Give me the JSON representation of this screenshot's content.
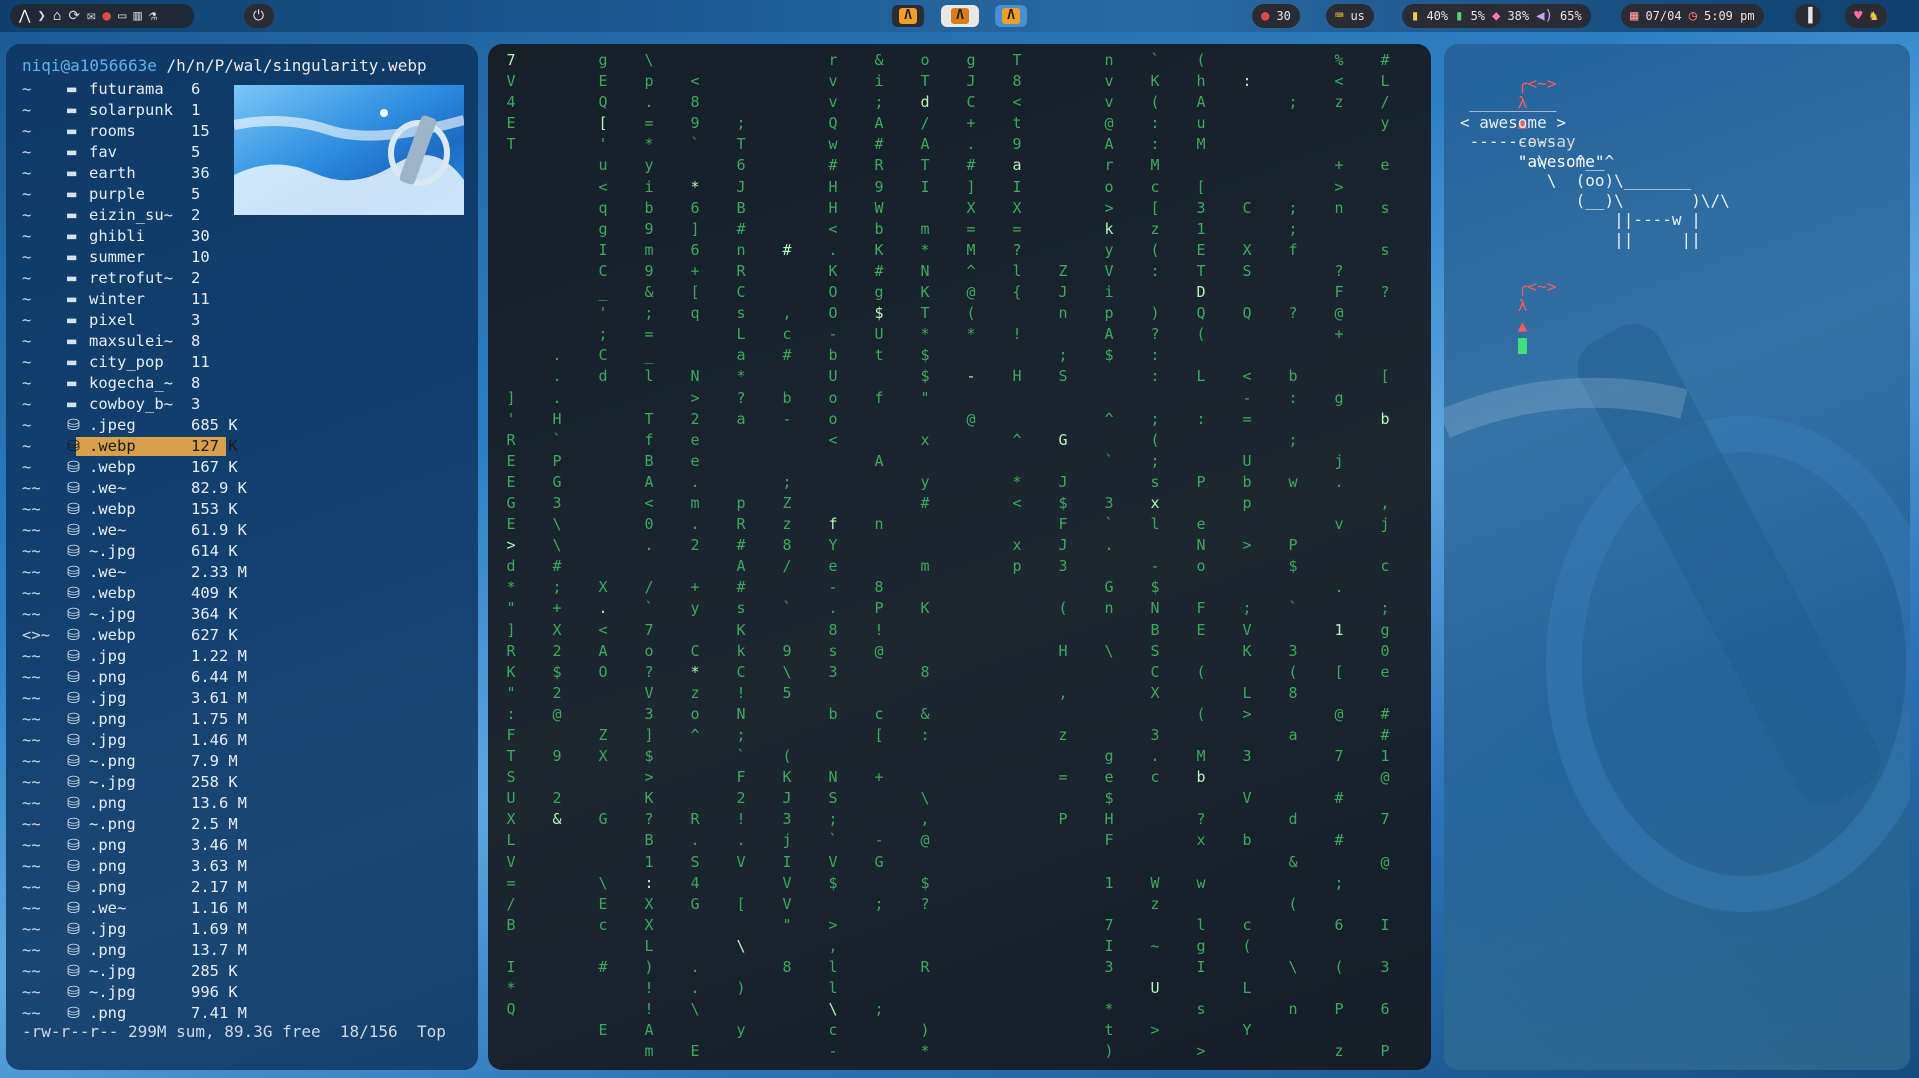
{
  "topbar": {
    "workspaces": [
      "Λ",
      "Λ",
      "Λ"
    ],
    "temperature": "30",
    "keyboard_layout": "us",
    "stats": {
      "battery": "40%",
      "disk": "5%",
      "memory": "38%",
      "volume": "65%"
    },
    "clock": {
      "date": "07/04",
      "time": "5:09 pm"
    }
  },
  "filemanager": {
    "user": "niqi@a1056663e",
    "path": "/h/n/P/wal/singularity.webp",
    "entries": [
      {
        "perm": "~",
        "name": "futurama",
        "size": "6",
        "dir": true
      },
      {
        "perm": "~",
        "name": "solarpunk",
        "size": "1",
        "dir": true
      },
      {
        "perm": "~",
        "name": "rooms",
        "size": "15",
        "dir": true
      },
      {
        "perm": "~",
        "name": "fav",
        "size": "5",
        "dir": true
      },
      {
        "perm": "~",
        "name": "earth",
        "size": "36",
        "dir": true
      },
      {
        "perm": "~",
        "name": "purple",
        "size": "5",
        "dir": true
      },
      {
        "perm": "~",
        "name": "eizin_su~",
        "size": "2",
        "dir": true
      },
      {
        "perm": "~",
        "name": "ghibli",
        "size": "30",
        "dir": true
      },
      {
        "perm": "~",
        "name": "summer",
        "size": "10",
        "dir": true
      },
      {
        "perm": "~",
        "name": "retrofut~",
        "size": "2",
        "dir": true
      },
      {
        "perm": "~",
        "name": "winter",
        "size": "11",
        "dir": true
      },
      {
        "perm": "~",
        "name": "pixel",
        "size": "3",
        "dir": true
      },
      {
        "perm": "~",
        "name": "maxsulei~",
        "size": "8",
        "dir": true
      },
      {
        "perm": "~",
        "name": "city_pop",
        "size": "11",
        "dir": true
      },
      {
        "perm": "~",
        "name": "kogecha_~",
        "size": "8",
        "dir": true
      },
      {
        "perm": "~",
        "name": "cowboy_b~",
        "size": "3",
        "dir": true
      },
      {
        "perm": "~",
        "name": ".jpeg",
        "size": "685 K",
        "dir": false
      },
      {
        "perm": "~",
        "name": ".webp",
        "size": "127 K",
        "dir": false,
        "selected": true
      },
      {
        "perm": "~",
        "name": ".webp",
        "size": "167 K",
        "dir": false
      },
      {
        "perm": "~~",
        "name": ".we~",
        "size": "82.9 K",
        "dir": false
      },
      {
        "perm": "~~",
        "name": ".webp",
        "size": "153 K",
        "dir": false
      },
      {
        "perm": "~~",
        "name": ".we~",
        "size": "61.9 K",
        "dir": false
      },
      {
        "perm": "~~",
        "name": "~.jpg",
        "size": "614 K",
        "dir": false
      },
      {
        "perm": "~~",
        "name": ".we~",
        "size": "2.33 M",
        "dir": false
      },
      {
        "perm": "~~",
        "name": ".webp",
        "size": "409 K",
        "dir": false
      },
      {
        "perm": "~~",
        "name": "~.jpg",
        "size": "364 K",
        "dir": false
      },
      {
        "perm": "<>~",
        "name": ".webp",
        "size": "627 K",
        "dir": false
      },
      {
        "perm": "~~",
        "name": ".jpg",
        "size": "1.22 M",
        "dir": false
      },
      {
        "perm": "~~",
        "name": ".png",
        "size": "6.44 M",
        "dir": false
      },
      {
        "perm": "~~",
        "name": ".jpg",
        "size": "3.61 M",
        "dir": false
      },
      {
        "perm": "~~",
        "name": ".png",
        "size": "1.75 M",
        "dir": false
      },
      {
        "perm": "~~",
        "name": ".jpg",
        "size": "1.46 M",
        "dir": false
      },
      {
        "perm": "~~",
        "name": "~.png",
        "size": "7.9 M",
        "dir": false
      },
      {
        "perm": "~~",
        "name": "~.jpg",
        "size": "258 K",
        "dir": false
      },
      {
        "perm": "~~",
        "name": ".png",
        "size": "13.6 M",
        "dir": false
      },
      {
        "perm": "~~",
        "name": "~.png",
        "size": "2.5 M",
        "dir": false
      },
      {
        "perm": "~~",
        "name": ".png",
        "size": "3.46 M",
        "dir": false
      },
      {
        "perm": "~~",
        "name": ".png",
        "size": "3.63 M",
        "dir": false
      },
      {
        "perm": "~~",
        "name": ".png",
        "size": "2.17 M",
        "dir": false
      },
      {
        "perm": "~~",
        "name": ".we~",
        "size": "1.16 M",
        "dir": false
      },
      {
        "perm": "~~",
        "name": ".jpg",
        "size": "1.69 M",
        "dir": false
      },
      {
        "perm": "~~",
        "name": ".png",
        "size": "13.7 M",
        "dir": false
      },
      {
        "perm": "~~",
        "name": "~.jpg",
        "size": "285 K",
        "dir": false
      },
      {
        "perm": "~~",
        "name": "~.jpg",
        "size": "996 K",
        "dir": false
      },
      {
        "perm": "~~",
        "name": ".png",
        "size": "7.41 M",
        "dir": false
      }
    ],
    "status": "-rw-r--r-- 299M sum, 89.3G free  18/156  Top"
  },
  "matrix": {
    "columns": [
      "7V4ET           ]'REEGE>d*\"]RK\":FTSUXLV=/B I*Q",
      "              ...H`PG3\\\\#;+X2$2@ 9 2&",
      "gEQ['u<qgIC_';Cd         X.<AO  ZX  G  \\Ec #  E  !  *  l2  h J",
      "\\p.=*yib9m9&;=_l TfBA<0. /`7o?V3]$>K?B1:XXL)!!Am B",
      " <89` *6]6+[q  N>2ee.m.2 +y C*zo^   R.S4G  ..\\ Ejp - x g4",
      "   ;T6JB#nRCsLa*?a   pR#A#sKkC!N;`F2!.V [ \\ ) y + ) r 8",
      "         #  ,c# b-  ;Zz8/ ` 9\\5  (KJ3jIVV\" 8",
      "rvvQw#HH<.KOO-bUoo<   fYe-.8s3 b  NS;`V$ >,ll\\c-z-Gi YgS4",
      "&i;A#R9WbK#g$Ut f  A  n  8P!@  c[ +  -G ;    ;",
      "oTd/ATI m*NKT*$$\" x y#  m K  8 &:  \\,@ $?  R  )*I  J",
      "gJC+.#]X=M^@(* - @ ",
      "T8<t9aIX=?l{ ! H  ^ *< xp",
      "          ZJn ;S  G J$FJ3 ( H , z = P",
      "nvv@Aro>kyVipA$  ^ ` 3`. Gn \\    ge$HF 1 7I3 *t)]^ \\ 0",
      "`K(::Mc[z(: )?:: ;(;sxl -$NBSCX 3.c    Wz ~ U >   n ; /",
      "(hAuM [31ETDQ( L :  P eNo FE ( ( Mb ?x w lgI s >  . < = $ r ( 1 J",
      " :     C XS Q  <-= Ubp >  ;VK L> 3 V b   c( L Y  \\ \\ 0 $ n & d -",
      "  ;    ;;f  ?  b: ; w  P$ ` 3(8 a   d & (  \\ n  x $ \\ Z ` ! 5  3 L X J  $ n& d",
      "%<z  +>n  ?F@+  g  j. v  . 1 [ @ 7 # # ; 6 ( P z 3 #",
      "#L/y e s s ?   [ b   ,j c ;g0e ##1@ 7 @  I 3 6 P h 3 #"
    ]
  },
  "terminal": {
    "prompt_top": "╭<~>",
    "prompt_symbol": "λ",
    "command": "cowsay",
    "argument": "\"awesome\"",
    "output": [
      " _________",
      "< awesome >",
      " ---------",
      "        \\   ^__^",
      "         \\  (oo)\\_______",
      "            (__)\\       )\\/\\",
      "                ||----w |",
      "                ||     ||"
    ]
  },
  "colors": {
    "accent": "#f0a02a",
    "selection": "#d8a04a",
    "matrix": "#3fa85c",
    "prompt": "#ff5a5a"
  },
  "icons": [
    "arch-icon",
    "chevron-icon",
    "home-icon",
    "refresh-icon",
    "mail-icon",
    "chat-icon",
    "folder-icon",
    "library-icon",
    "flask-icon",
    "power-icon",
    "thermometer-icon",
    "keyboard-icon",
    "battery-icon",
    "disk-icon",
    "memory-icon",
    "volume-icon",
    "calendar-icon",
    "clock-icon",
    "sidebar-icon",
    "heart-icon",
    "tray-icon"
  ]
}
